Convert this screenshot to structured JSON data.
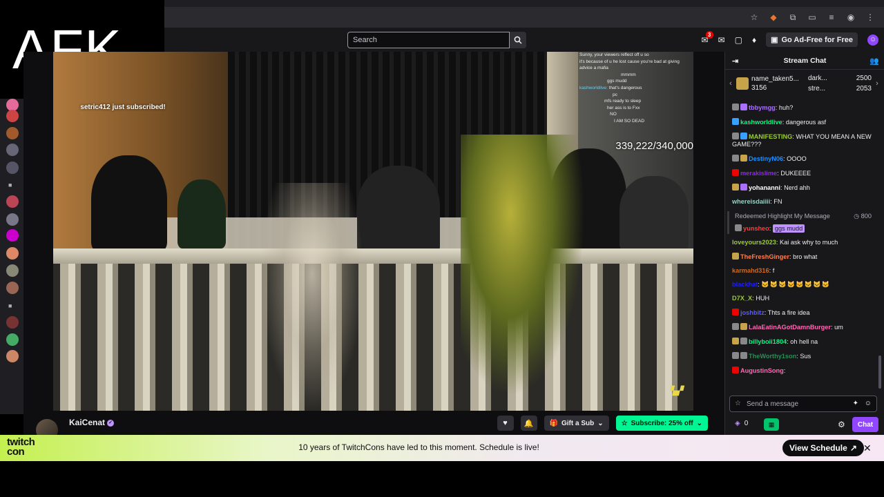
{
  "overlay": {
    "afk_text": "AFK"
  },
  "topnav": {
    "search_placeholder": "Search",
    "notifications_count": "3",
    "adfree_label": "Go Ad-Free for Free"
  },
  "stream": {
    "sub_alert_user": "setric412",
    "sub_alert_text": "just subscribed!",
    "counter": "339,222/340,000",
    "overlay_chat": [
      {
        "user": "",
        "text": "Sunny, your viewers reflect off u so"
      },
      {
        "user": "",
        "text": "it's because of u he lost cause you're bad at giving"
      },
      {
        "user": "",
        "text": "advice a mafia"
      },
      {
        "user": "",
        "text": "mmmm"
      },
      {
        "user": "",
        "text": "ggs mudd"
      },
      {
        "user": "kashworldlive:",
        "text": "that's dangerous"
      },
      {
        "user": "",
        "text": "pc"
      },
      {
        "user": "",
        "text": "mfs ready to sleep"
      },
      {
        "user": "",
        "text": "her ass is to Fxx"
      },
      {
        "user": "",
        "text": "NO"
      },
      {
        "user": "",
        "text": "I AM SO DEAD"
      }
    ]
  },
  "channel": {
    "name": "KaiCenat",
    "gift_label": "Gift a Sub",
    "subscribe_label": "Subscribe: 25% off"
  },
  "promo": {
    "logo_line1": "twitch",
    "logo_line2": "con",
    "text": "10 years of TwitchCons have led to this moment. Schedule is live!",
    "button": "View Schedule"
  },
  "chat": {
    "title": "Stream Chat",
    "gift_top_user": "name_taken5...",
    "gift_top_count": "3156",
    "gift_side": [
      {
        "user": "dark...",
        "count": "2500"
      },
      {
        "user": "stre...",
        "count": "2053"
      }
    ],
    "messages": [
      {
        "user": "tbbymgg",
        "color": "#a970ff",
        "text": "huh?",
        "badges": [
          "#888",
          "#a970ff"
        ]
      },
      {
        "user": "kashworldlive",
        "color": "#00ff7f",
        "text": "dangerous asf",
        "badges": [
          "#3aa0ff"
        ]
      },
      {
        "user": "MANIFESTING",
        "color": "#9acd32",
        "text": "WHAT YOU MEAN A NEW GAME???",
        "badges": [
          "#888",
          "#3aa0ff"
        ]
      },
      {
        "user": "DestinyN06",
        "color": "#1e90ff",
        "text": "OOOO",
        "badges": [
          "#888",
          "#c7a34a"
        ]
      },
      {
        "user": "merakislime",
        "color": "#8a2be2",
        "text": "DUKEEEE",
        "badges": [
          "#eb0400"
        ]
      },
      {
        "user": "yohananni",
        "color": "#ffffff",
        "text": "Nerd ahh",
        "badges": [
          "#c7a34a",
          "#a970ff"
        ]
      },
      {
        "user": "whereisdaiiii",
        "color": "#9ad0c2",
        "text": "FN",
        "badges": []
      }
    ],
    "highlight": {
      "title": "Redeemed Highlight My Message",
      "cost": "800",
      "user": "yunsheo",
      "text": "ggs mudd"
    },
    "messages2": [
      {
        "user": "loveyours2023",
        "color": "#9acd32",
        "text": "Kai ask why to much",
        "badges": []
      },
      {
        "user": "TheFreshGinger",
        "color": "#ff7f50",
        "text": "bro what",
        "badges": [
          "#c7a34a"
        ]
      },
      {
        "user": "karmahd316",
        "color": "#d2691e",
        "text": "f",
        "badges": []
      },
      {
        "user": "blackhat",
        "color": "#1e1eff",
        "text": "",
        "badges": [],
        "emotes": "🐱🐱🐱🐱🐱🐱🐱🐱"
      },
      {
        "user": "D7X_X",
        "color": "#9acd32",
        "text": "HUH",
        "badges": []
      },
      {
        "user": "joshbitz",
        "color": "#5a5aff",
        "text": "Thts a fire idea",
        "badges": [
          "#eb0400"
        ]
      },
      {
        "user": "LalaEatinAGotDamnBurger",
        "color": "#ff69b4",
        "text": "um",
        "badges": [
          "#888",
          "#c7a34a"
        ]
      },
      {
        "user": "billyboii1804",
        "color": "#00ff7f",
        "text": "oh hell na",
        "badges": [
          "#c7a34a",
          "#888"
        ]
      },
      {
        "user": "TheWorthy1son",
        "color": "#2e8b57",
        "text": "Sus",
        "badges": [
          "#888",
          "#888"
        ]
      },
      {
        "user": "AugustinSong",
        "color": "#ff69b4",
        "text": "",
        "badges": [
          "#eb0400"
        ]
      }
    ],
    "input_placeholder": "Send a message",
    "points": "0",
    "chat_button": "Chat"
  }
}
